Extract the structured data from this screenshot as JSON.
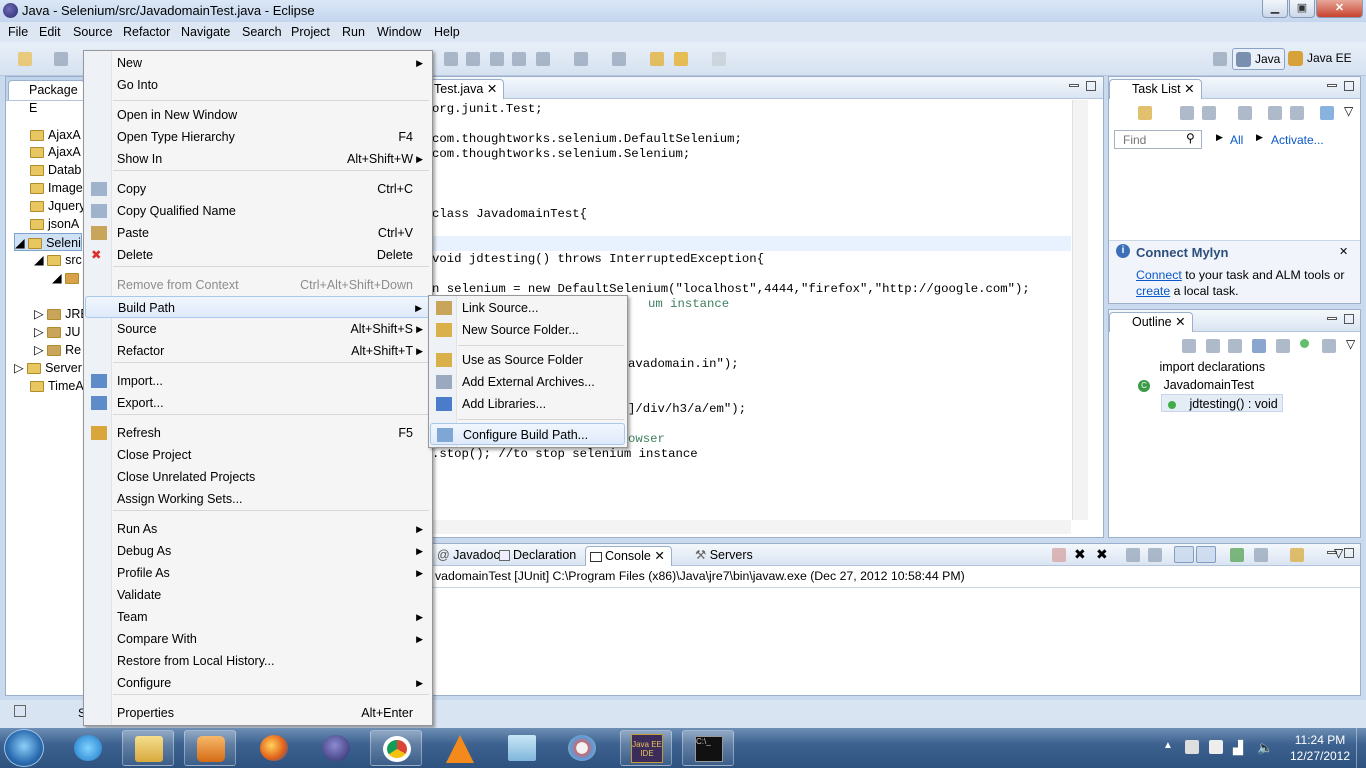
{
  "window": {
    "title": "Java - Selenium/src/JavadomainTest.java - Eclipse",
    "controls": [
      "minimize",
      "maximize",
      "close"
    ]
  },
  "menubar": [
    "File",
    "Edit",
    "Source",
    "Refactor",
    "Navigate",
    "Search",
    "Project",
    "Run",
    "Window",
    "Help"
  ],
  "perspectives": {
    "java": "Java",
    "javaee": "Java EE"
  },
  "package_explorer": {
    "tab": "Package E",
    "items": [
      "AjaxA",
      "AjaxA",
      "Datab",
      "Image",
      "Jquery",
      "jsonA",
      "Seleni",
      "src",
      "",
      "",
      "JRE",
      "JU",
      "Re",
      "Server",
      "TimeA"
    ]
  },
  "editor": {
    "tab": "Test.java",
    "lines": [
      "org.junit.Test;",
      "com.thoughtworks.selenium.DefaultSelenium;",
      "com.thoughtworks.selenium.Selenium;",
      "class JavadomainTest{",
      "void jdtesting() throws InterruptedException{",
      "n selenium = new DefaultSelenium(\"localhost\",4444,\"firefox\",\"http://google.com\");",
      "um instance",
      "avadomain.in\");",
      "]/div/h3/a/em\");",
      "owser",
      ".stop(); //to stop selenium instance"
    ]
  },
  "task_list": {
    "tab": "Task List",
    "find_placeholder": "Find",
    "all_label": "All",
    "activate_label": "Activate..."
  },
  "mylyn": {
    "title": "Connect Mylyn",
    "connect_link": "Connect",
    "text1": " to your task and ALM tools or",
    "create_link": "create",
    "text2": " a local task."
  },
  "outline": {
    "tab": "Outline",
    "items": [
      "import declarations",
      "JavadomainTest",
      "jdtesting() : void"
    ]
  },
  "bottom_panel": {
    "tabs": [
      "Javadoc",
      "Declaration",
      "Console",
      "Servers"
    ],
    "console_header": "vadomainTest [JUnit] C:\\Program Files (x86)\\Java\\jre7\\bin\\javaw.exe (Dec 27, 2012 10:58:44 PM)"
  },
  "status_bar": {
    "text": "S"
  },
  "context_menu": {
    "items": [
      {
        "label": "New",
        "shortcut": "",
        "submenu": true
      },
      {
        "label": "Go Into",
        "shortcut": "",
        "submenu": false
      },
      {
        "label": "Open in New Window",
        "shortcut": "",
        "submenu": false
      },
      {
        "label": "Open Type Hierarchy",
        "shortcut": "F4",
        "submenu": false
      },
      {
        "label": "Show In",
        "shortcut": "Alt+Shift+W",
        "submenu": true
      },
      {
        "label": "Copy",
        "shortcut": "Ctrl+C",
        "submenu": false
      },
      {
        "label": "Copy Qualified Name",
        "shortcut": "",
        "submenu": false
      },
      {
        "label": "Paste",
        "shortcut": "Ctrl+V",
        "submenu": false
      },
      {
        "label": "Delete",
        "shortcut": "Delete",
        "submenu": false
      },
      {
        "label": "Remove from Context",
        "shortcut": "Ctrl+Alt+Shift+Down",
        "submenu": false
      },
      {
        "label": "Build Path",
        "shortcut": "",
        "submenu": true
      },
      {
        "label": "Source",
        "shortcut": "Alt+Shift+S",
        "submenu": true
      },
      {
        "label": "Refactor",
        "shortcut": "Alt+Shift+T",
        "submenu": true
      },
      {
        "label": "Import...",
        "shortcut": "",
        "submenu": false
      },
      {
        "label": "Export...",
        "shortcut": "",
        "submenu": false
      },
      {
        "label": "Refresh",
        "shortcut": "F5",
        "submenu": false
      },
      {
        "label": "Close Project",
        "shortcut": "",
        "submenu": false
      },
      {
        "label": "Close Unrelated Projects",
        "shortcut": "",
        "submenu": false
      },
      {
        "label": "Assign Working Sets...",
        "shortcut": "",
        "submenu": false
      },
      {
        "label": "Run As",
        "shortcut": "",
        "submenu": true
      },
      {
        "label": "Debug As",
        "shortcut": "",
        "submenu": true
      },
      {
        "label": "Profile As",
        "shortcut": "",
        "submenu": true
      },
      {
        "label": "Validate",
        "shortcut": "",
        "submenu": false
      },
      {
        "label": "Team",
        "shortcut": "",
        "submenu": true
      },
      {
        "label": "Compare With",
        "shortcut": "",
        "submenu": true
      },
      {
        "label": "Restore from Local History...",
        "shortcut": "",
        "submenu": false
      },
      {
        "label": "Configure",
        "shortcut": "",
        "submenu": true
      },
      {
        "label": "Properties",
        "shortcut": "Alt+Enter",
        "submenu": false
      }
    ]
  },
  "build_path_submenu": {
    "items": [
      "Link Source...",
      "New Source Folder...",
      "Use as Source Folder",
      "Add External Archives...",
      "Add Libraries...",
      "Configure Build Path..."
    ]
  },
  "taskbar": {
    "apps": [
      "start",
      "internet-explorer",
      "file-explorer",
      "media-player",
      "firefox",
      "eclipse",
      "chrome",
      "vlc",
      "notepad",
      "paint",
      "java-ee-ide",
      "command-prompt"
    ],
    "javaee_label": "Java EE IDE",
    "time": "11:24 PM",
    "date": "12/27/2012"
  },
  "colors": {
    "accent": "#3d6290",
    "keyword": "#7f0055",
    "string": "#2a00ff",
    "comment": "#3f7f5f",
    "link": "#0a58ca"
  }
}
